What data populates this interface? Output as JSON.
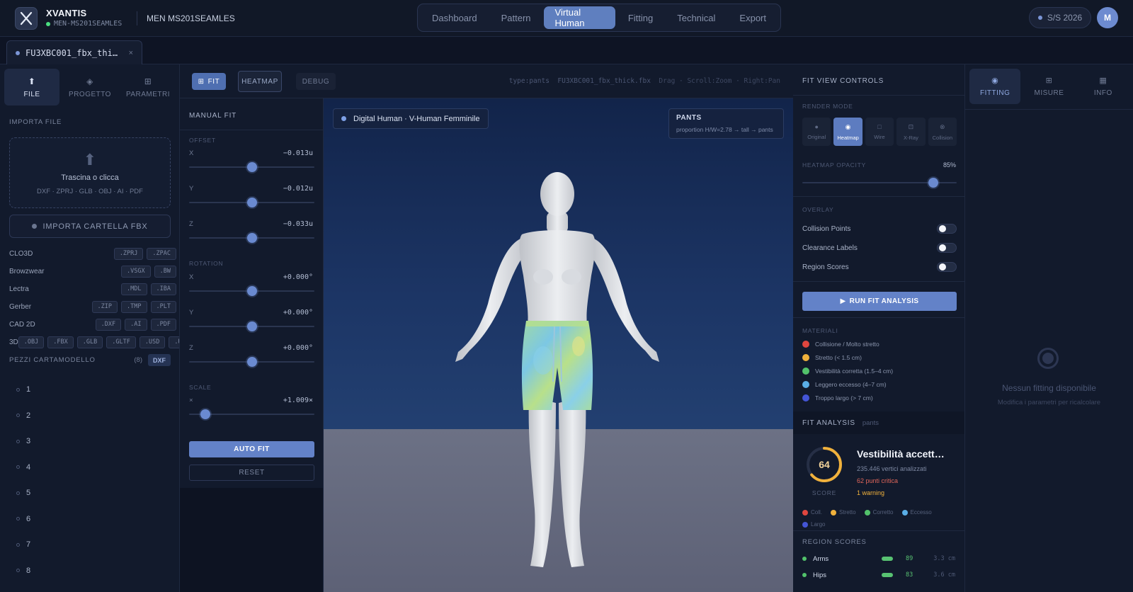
{
  "app": {
    "brand": "XVANTIS",
    "brand_sub": "MEN-MS201SEAMLES",
    "project_name": "MEN MS201SEAMLES",
    "season": "S/S 2026",
    "avatar_initial": "M"
  },
  "nav": {
    "tabs": [
      "Dashboard",
      "Pattern",
      "Virtual Human",
      "Fitting",
      "Technical",
      "Export"
    ],
    "active": "Virtual Human"
  },
  "file_tab": {
    "name": "FU3XBC001_fbx_thi…",
    "close": "×"
  },
  "left_panel": {
    "tabs": [
      {
        "label": "FILE",
        "icon": "⬆",
        "icon_name": "upload-icon"
      },
      {
        "label": "PROGETTO",
        "icon": "◈",
        "icon_name": "project-icon"
      },
      {
        "label": "PARAMETRI",
        "icon": "⊞",
        "icon_name": "grid-icon"
      }
    ],
    "import_title": "IMPORTA FILE",
    "dropzone_title": "Trascina o clicca",
    "dropzone_formats": "DXF · ZPRJ · GLB · OBJ · AI · PDF",
    "import_fbx_label": "IMPORTA CARTELLA FBX",
    "formats": [
      {
        "name": "CLO3D",
        "badges": [
          ".ZPRJ",
          ".ZPAC"
        ]
      },
      {
        "name": "Browzwear",
        "badges": [
          ".VSGX",
          ".BW"
        ]
      },
      {
        "name": "Lectra",
        "badges": [
          ".MDL",
          ".IBA"
        ]
      },
      {
        "name": "Gerber",
        "badges": [
          ".ZIP",
          ".TMP",
          ".PLT"
        ]
      },
      {
        "name": "CAD 2D",
        "badges": [
          ".DXF",
          ".AI",
          ".PDF"
        ]
      },
      {
        "name": "3D",
        "badges": [
          ".OBJ",
          ".FBX",
          ".GLB",
          ".GLTF",
          ".USD",
          ".USD"
        ]
      }
    ],
    "pieces_title": "PEZZI CARTAMODELLO",
    "pieces_count": "(8)",
    "pieces_badge": "DXF",
    "pieces": [
      "1",
      "2",
      "3",
      "4",
      "5",
      "6",
      "7",
      "8"
    ]
  },
  "toolbar": {
    "fit_label": "FIT",
    "heatmap_label": "HEATMAP",
    "debug_label": "DEBUG",
    "info_type": "type:pants",
    "info_file": "FU3XBC001_fbx_thick.fbx",
    "info_hint": "Drag · Scroll:Zoom · Right:Pan"
  },
  "manual_fit": {
    "title": "MANUAL FIT",
    "offset_label": "OFFSET",
    "rotation_label": "ROTATION",
    "scale_label": "SCALE",
    "offset": [
      {
        "axis": "X",
        "value": "−0.013u",
        "pos": 0.5
      },
      {
        "axis": "Y",
        "value": "−0.012u",
        "pos": 0.5
      },
      {
        "axis": "Z",
        "value": "−0.033u",
        "pos": 0.5
      }
    ],
    "rotation": [
      {
        "axis": "X",
        "value": "+0.000°",
        "pos": 0.5
      },
      {
        "axis": "Y",
        "value": "+0.000°",
        "pos": 0.5
      },
      {
        "axis": "Z",
        "value": "+0.000°",
        "pos": 0.5
      }
    ],
    "scale": {
      "axis": "×",
      "value": "+1.009×",
      "pos": 0.13
    },
    "auto_fit_label": "AUTO FIT",
    "reset_label": "RESET"
  },
  "viewport": {
    "avatar_label": "Digital Human · V-Human Femminile",
    "type_title": "PANTS",
    "type_detail": "proportion H/W=2.78 → tall → pants"
  },
  "fit_controls": {
    "title": "FIT VIEW CONTROLS",
    "render_mode_label": "RENDER MODE",
    "modes": [
      {
        "label": "Original",
        "icon": "●"
      },
      {
        "label": "Heatmap",
        "icon": "◉"
      },
      {
        "label": "Wire",
        "icon": "□"
      },
      {
        "label": "X-Ray",
        "icon": "⊡"
      },
      {
        "label": "Collision",
        "icon": "⊗"
      }
    ],
    "active_mode": "Heatmap",
    "opacity_label": "HEATMAP OPACITY",
    "opacity_value": "85%",
    "opacity_level": 0.85,
    "overlay_label": "OVERLAY",
    "overlays": [
      {
        "label": "Collision Points",
        "on": false
      },
      {
        "label": "Clearance Labels",
        "on": false
      },
      {
        "label": "Region Scores",
        "on": false
      }
    ],
    "run_label": "RUN FIT ANALYSIS",
    "materials_label": "MATERIALI",
    "materials": [
      {
        "label": "Collisione / Molto stretto",
        "color": "#e0463f"
      },
      {
        "label": "Stretto (< 1.5 cm)",
        "color": "#f0b13c"
      },
      {
        "label": "Vestibilità corretta (1.5–4 cm)",
        "color": "#52c26b"
      },
      {
        "label": "Leggero eccesso (4–7 cm)",
        "color": "#5aaee6"
      },
      {
        "label": "Troppo largo (> 7 cm)",
        "color": "#4455d6"
      }
    ]
  },
  "fit_analysis": {
    "title": "FIT ANALYSIS",
    "subtitle": "pants",
    "score": "64",
    "score_value": 64,
    "score_label": "SCORE",
    "verdict": "Vestibilità accett…",
    "vertices": "235.446 vertici analizzati",
    "critical": "62 punti critica",
    "warning": "1 warning",
    "legend": [
      {
        "label": "Coll.",
        "color": "#e0463f"
      },
      {
        "label": "Stretto",
        "color": "#f0b13c"
      },
      {
        "label": "Corretto",
        "color": "#52c26b"
      },
      {
        "label": "Eccesso",
        "color": "#5aaee6"
      },
      {
        "label": "Largo",
        "color": "#4455d6"
      }
    ],
    "regions_title": "REGION SCORES",
    "regions": [
      {
        "name": "Arms",
        "score": "89",
        "cm": "3.3 cm"
      },
      {
        "name": "Hips",
        "score": "83",
        "cm": "3.6 cm"
      }
    ]
  },
  "right_panel": {
    "tabs": [
      {
        "label": "FITTING",
        "icon": "◉"
      },
      {
        "label": "MISURE",
        "icon": "⊞"
      },
      {
        "label": "INFO",
        "icon": "▦"
      }
    ],
    "empty_title": "Nessun fitting disponibile",
    "empty_sub": "Modifica i parametri per ricalcolare"
  }
}
